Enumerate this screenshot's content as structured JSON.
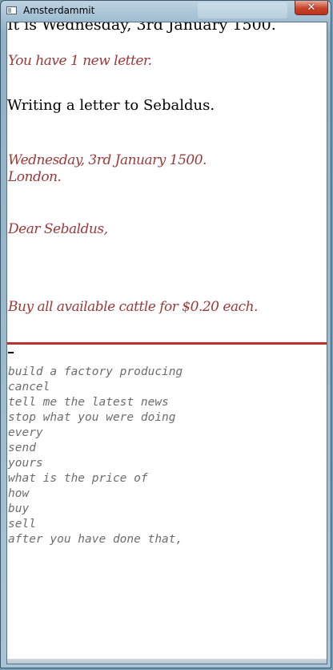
{
  "window": {
    "title": "Amsterdammit"
  },
  "letter": {
    "top_line": "It is Wednesday, 3rd January 1500.",
    "notification": "You have 1 new letter.",
    "status": "Writing a letter to Sebaldus.",
    "date": "Wednesday, 3rd January 1500.",
    "place": "London.",
    "salutation": "Dear Sebaldus,",
    "body": "Buy all available cattle for $0.20 each."
  },
  "suggestions": [
    "build a factory producing",
    "cancel",
    "tell me the latest news",
    "stop what you were doing",
    "every",
    "send",
    "yours",
    "what is the price of",
    "how",
    "buy",
    "sell",
    "after you have done that,"
  ],
  "icons": {
    "app": "window-icon",
    "close": "close-icon"
  },
  "colors": {
    "script_text": "#9a3a3a",
    "divider": "#c0302b",
    "suggestion_text": "#6d6d6d"
  }
}
